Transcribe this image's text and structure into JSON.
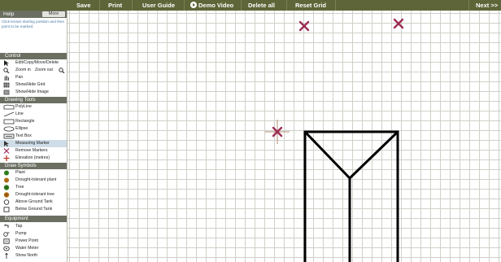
{
  "toolbar": {
    "save": "Save",
    "print": "Print",
    "user_guide": "User Guide",
    "demo_video": "Demo Video",
    "delete_all": "Delete all",
    "reset_grid": "Reset Grid",
    "next": "Next >>"
  },
  "help": {
    "title": "Help",
    "more": "More",
    "text": "Click known starting position and then point to be marked."
  },
  "control": {
    "title": "Control",
    "items": [
      {
        "label": "Edit/Copy/Move/Delete",
        "icon": "cursor-icon"
      },
      {
        "zoom_in": "Zoom in",
        "zoom_out": "Zoom out",
        "icon": "magnifier-icon"
      },
      {
        "label": "Pan",
        "icon": "hand-icon"
      },
      {
        "label": "Show/Hide Grid",
        "icon": "grid-icon"
      },
      {
        "label": "Show/Hide Image",
        "icon": "image-icon"
      }
    ]
  },
  "drawing_tools": {
    "title": "Drawing Tools",
    "items": [
      {
        "label": "PolyLine",
        "icon": "polyline-icon"
      },
      {
        "label": "Line",
        "icon": "line-icon"
      },
      {
        "label": "Rectangle",
        "icon": "rectangle-icon"
      },
      {
        "label": "Ellipse",
        "icon": "ellipse-icon"
      },
      {
        "label": "Text Box",
        "icon": "textbox-icon"
      },
      {
        "label": "Measuring Marker",
        "icon": "measure-icon",
        "selected": true
      },
      {
        "label": "Remove Markers",
        "icon": "remove-marker-icon"
      },
      {
        "label": "Elevation (metres)",
        "icon": "elevation-icon"
      }
    ]
  },
  "draw_symbols": {
    "title": "Draw Symbols",
    "items": [
      {
        "label": "Plant",
        "icon": "plant-icon",
        "color": "#2e7d1e"
      },
      {
        "label": "Drought-tolerant plant",
        "icon": "drought-plant-icon",
        "color": "#b06a14"
      },
      {
        "label": "Tree",
        "icon": "tree-icon",
        "color": "#2e7d1e"
      },
      {
        "label": "Drought-tolerant tree",
        "icon": "drought-tree-icon",
        "color": "#b06a14"
      },
      {
        "label": "Above Ground Tank",
        "icon": "above-tank-icon"
      },
      {
        "label": "Below Ground Tank",
        "icon": "below-tank-icon"
      }
    ]
  },
  "equipment": {
    "title": "Equipment",
    "items": [
      {
        "label": "Tap",
        "icon": "tap-icon"
      },
      {
        "label": "Pump",
        "icon": "pump-icon"
      },
      {
        "label": "Power Point",
        "icon": "power-point-icon"
      },
      {
        "label": "Water Meter",
        "icon": "water-meter-icon"
      },
      {
        "label": "Show North",
        "icon": "north-icon"
      }
    ]
  },
  "colors": {
    "toolbar": "#5e6538",
    "section_header": "#6b6f62",
    "marker": "#9c2d55",
    "grid": "#cfd1c8",
    "selected": "#cfdde8"
  }
}
